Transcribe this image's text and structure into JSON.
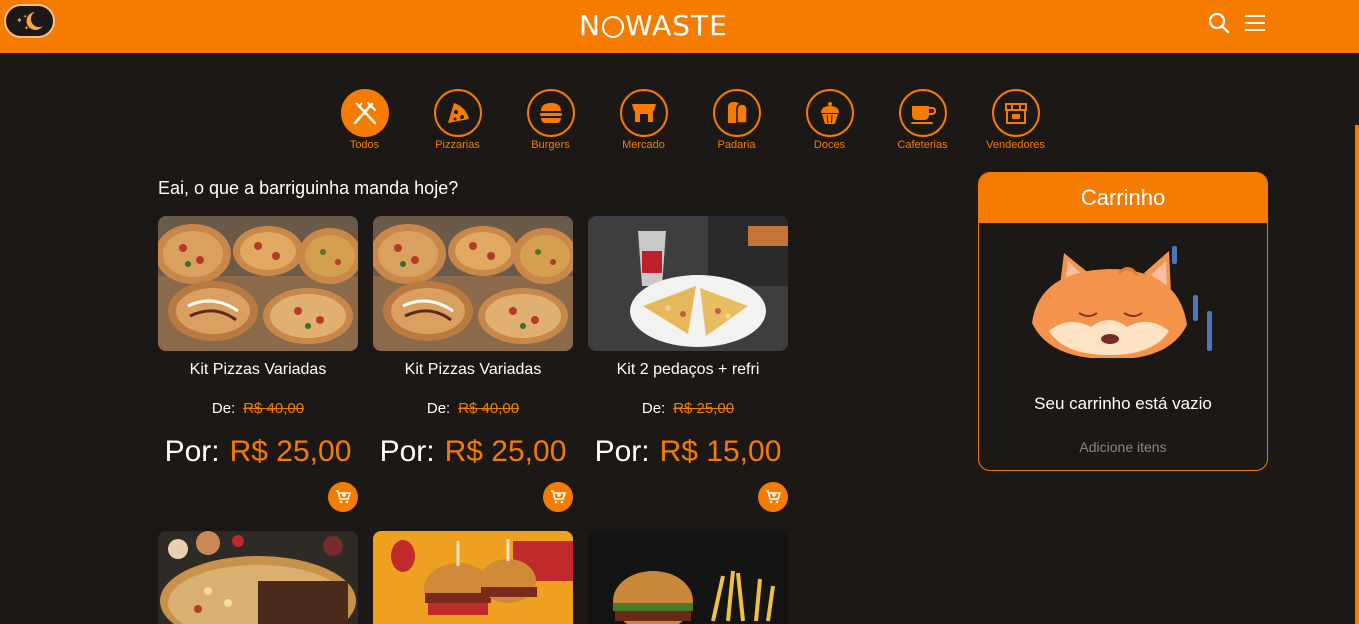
{
  "header": {
    "logo": "NOWASTE",
    "logo_parts": [
      "N",
      "WASTE"
    ],
    "theme_toggle_icon": "moon-stars-icon",
    "search_icon": "search-icon",
    "menu_icon": "hamburger-menu-icon",
    "accent": "#f57c00"
  },
  "categories": [
    {
      "label": "Todos",
      "icon": "fork-knife-icon",
      "active": true
    },
    {
      "label": "Pizzarias",
      "icon": "pizza-icon"
    },
    {
      "label": "Burgers",
      "icon": "burger-icon"
    },
    {
      "label": "Mercado",
      "icon": "store-icon"
    },
    {
      "label": "Padaria",
      "icon": "bread-icon"
    },
    {
      "label": "Doces",
      "icon": "cupcake-icon"
    },
    {
      "label": "Cafeterias",
      "icon": "coffee-cup-icon"
    },
    {
      "label": "Vendedores",
      "icon": "vendor-shop-icon"
    }
  ],
  "greeting": "Eai, o que a barriguinha manda hoje?",
  "products": [
    {
      "title": "Kit Pizzas Variadas",
      "from_label": "De:",
      "old_price": "R$ 40,00",
      "by_label": "Por:",
      "price": "R$ 25,00"
    },
    {
      "title": "Kit Pizzas Variadas",
      "from_label": "De:",
      "old_price": "R$ 40,00",
      "by_label": "Por:",
      "price": "R$ 25,00"
    },
    {
      "title": "Kit 2 pedaços + refri",
      "from_label": "De:",
      "old_price": "R$ 25,00",
      "by_label": "Por:",
      "price": "R$ 15,00"
    }
  ],
  "cart": {
    "title": "Carrinho",
    "empty_text": "Seu carrinho está vazio",
    "hint": "Adicione itens"
  }
}
